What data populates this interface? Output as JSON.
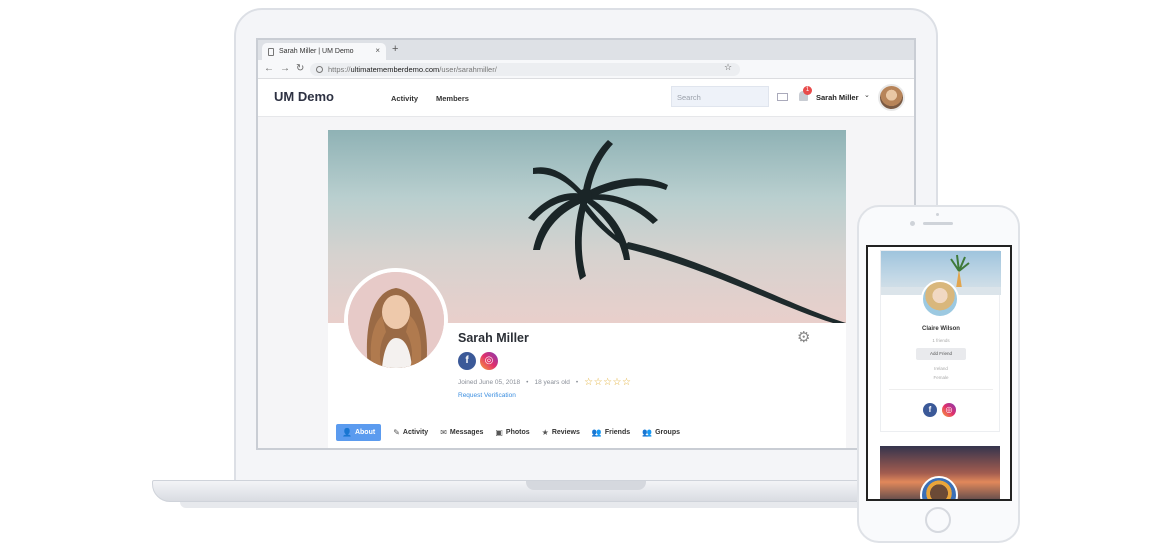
{
  "browser": {
    "tab_title": "Sarah Miller | UM Demo",
    "tab_close": "×",
    "new_tab": "+",
    "url_scheme": "https://",
    "url_host": "ultimatememberdemo.com",
    "url_path": "/user/sarahmiller/"
  },
  "header": {
    "logo": "UM Demo",
    "nav": [
      "Activity",
      "Members"
    ],
    "search_placeholder": "Search",
    "notification_count": "1",
    "user_name": "Sarah Miller"
  },
  "profile": {
    "name": "Sarah Miller",
    "joined": "Joined June 05, 2018",
    "age": "18 years old",
    "rating_stars": "☆☆☆☆☆",
    "rating_value": 0,
    "request_verification": "Request Verification",
    "facebook_glyph": "f",
    "instagram_glyph": "◎",
    "tabs": [
      {
        "icon": "👤",
        "label": "About",
        "active": true
      },
      {
        "icon": "✎",
        "label": "Activity"
      },
      {
        "icon": "✉",
        "label": "Messages"
      },
      {
        "icon": "▣",
        "label": "Photos"
      },
      {
        "icon": "★",
        "label": "Reviews"
      },
      {
        "icon": "👥",
        "label": "Friends"
      },
      {
        "icon": "👥",
        "label": "Groups"
      }
    ]
  },
  "mobile": {
    "card": {
      "name": "Claire Wilson",
      "friends": "1  friends",
      "add_friend": "Add Friend",
      "country": "Ireland",
      "gender": "Female"
    }
  },
  "colors": {
    "accent": "#5b9bef",
    "facebook": "#3b5998",
    "badge": "#e84b4b",
    "star": "#e2b13c"
  }
}
